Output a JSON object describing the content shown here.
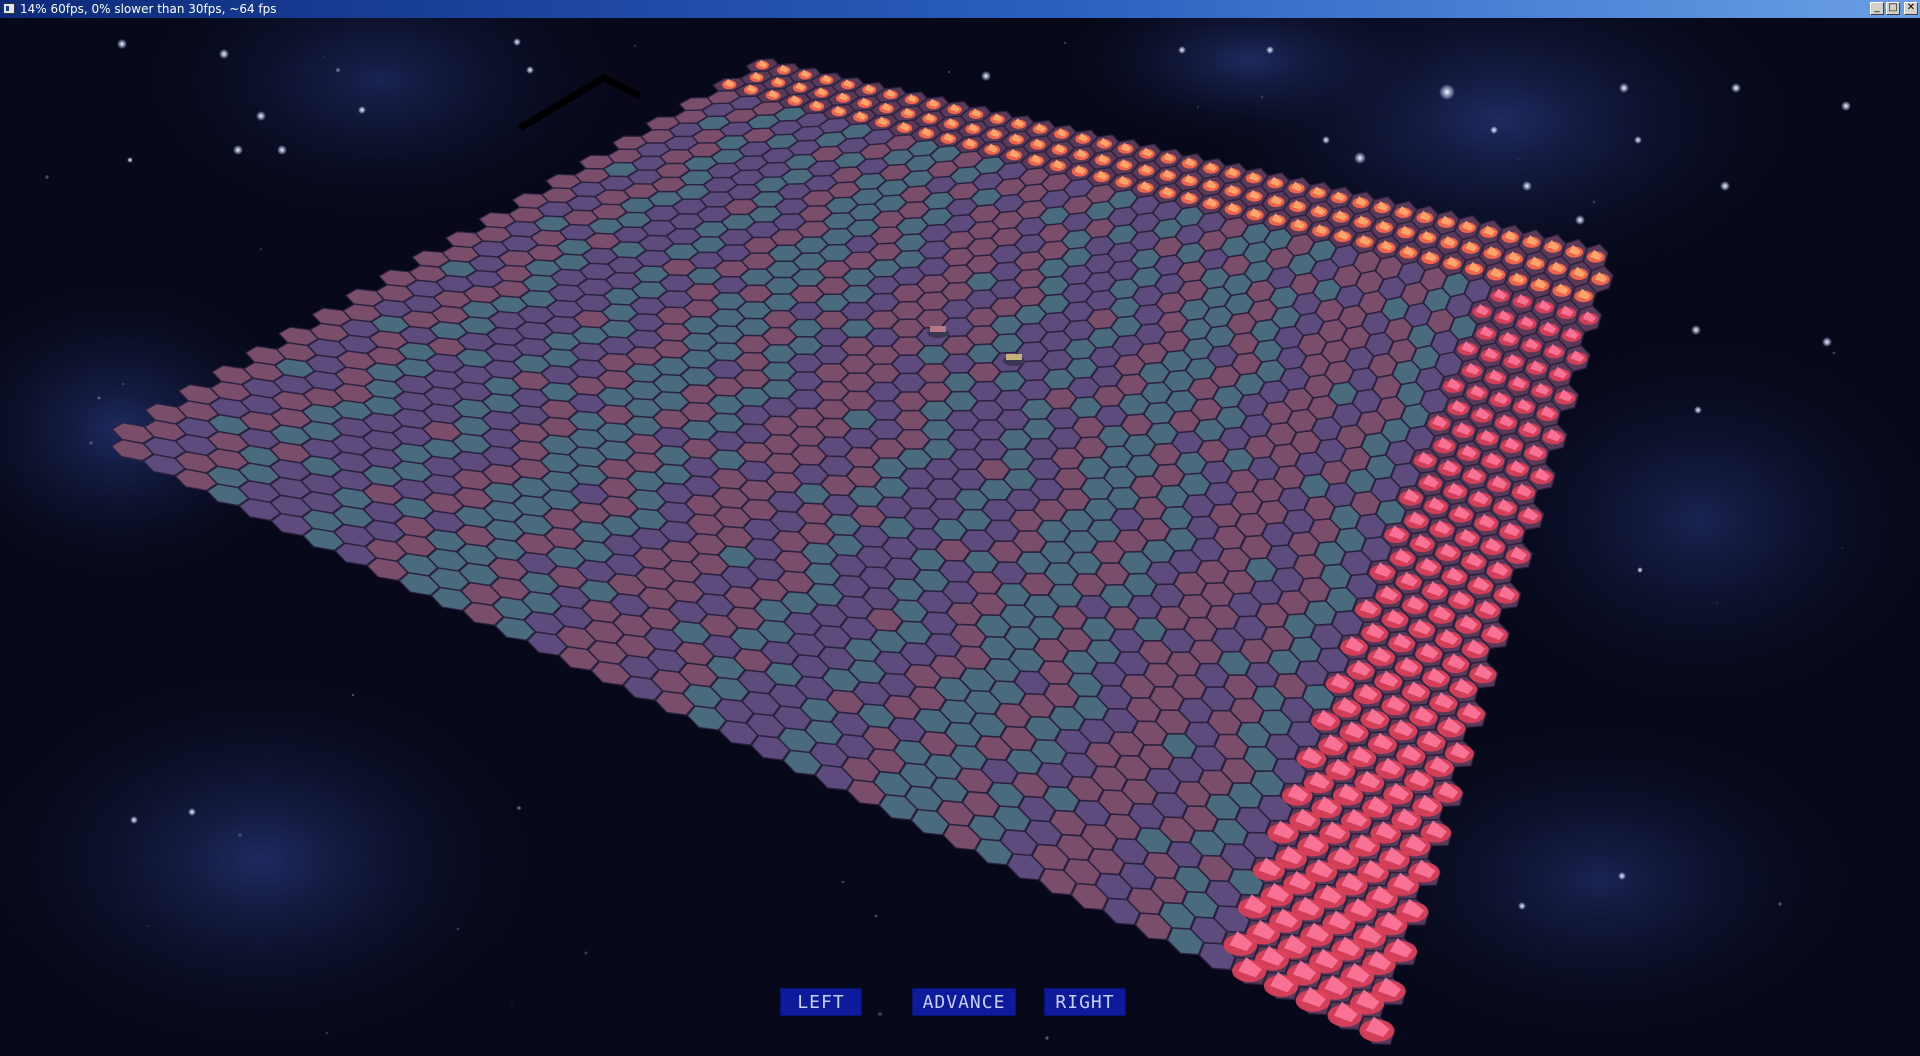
{
  "window": {
    "title": "14% 60fps, 0% slower than 30fps, ~64 fps",
    "controls": {
      "minimize": "_",
      "maximize": "□",
      "close": "✕"
    }
  },
  "colors": {
    "space": "#07091a",
    "tile_teal": "#4a6a7e",
    "tile_rose": "#7a4d6a",
    "tile_violet": "#5d4b7e",
    "tile_edge": "#2b2240",
    "unit_red": "#ff5a4a",
    "hud_button": "#0e1a9c"
  },
  "board": {
    "type": "hex-grid",
    "terrain_tiles": [
      "teal",
      "rose",
      "violet"
    ],
    "unit_icon": "red-crystal-unit-icon"
  },
  "controls": {
    "left_label": "LEFT",
    "advance_label": "ADVANCE",
    "right_label": "RIGHT"
  }
}
